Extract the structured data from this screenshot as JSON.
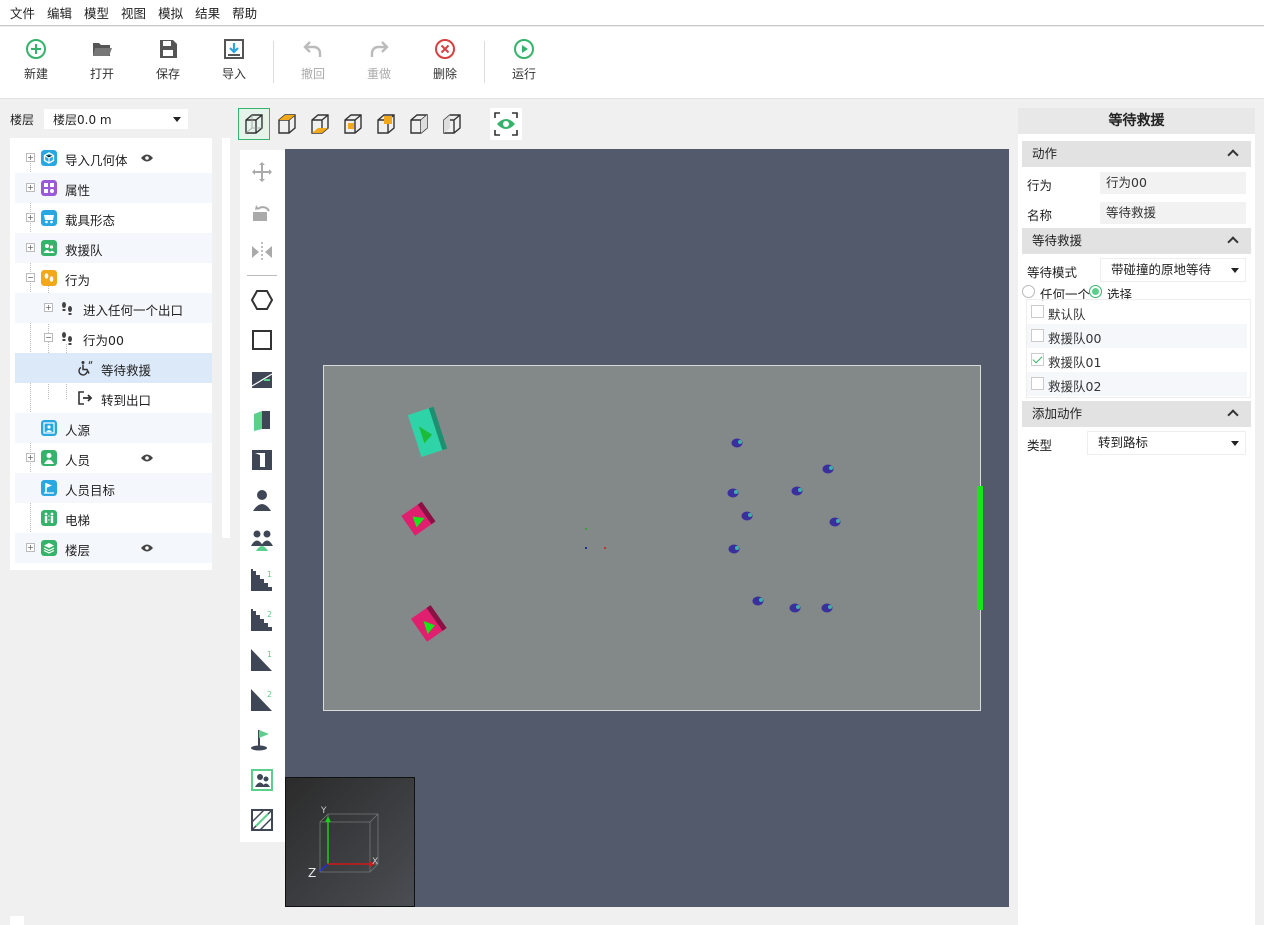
{
  "menu": [
    "文件",
    "编辑",
    "模型",
    "视图",
    "模拟",
    "结果",
    "帮助"
  ],
  "toolbar": {
    "new": "新建",
    "open": "打开",
    "save": "保存",
    "import": "导入",
    "undo": "撤回",
    "redo": "重做",
    "delete": "删除",
    "run": "运行"
  },
  "floor": {
    "label": "楼层",
    "value": "楼层0.0 m"
  },
  "tree": {
    "items": [
      {
        "label": "导入几何体",
        "icon": "geometry-icon",
        "color": "#29a7e0"
      },
      {
        "label": "属性",
        "icon": "property-icon",
        "color": "#9b59d9"
      },
      {
        "label": "载具形态",
        "icon": "vehicle-icon",
        "color": "#29a7e0"
      },
      {
        "label": "救援队",
        "icon": "team-icon",
        "color": "#36b36b"
      },
      {
        "label": "行为",
        "icon": "behavior-icon",
        "color": "#f2a81b"
      },
      {
        "label": "进入任何一个出口",
        "icon": "footsteps-icon"
      },
      {
        "label": "行为00",
        "icon": "footsteps-icon"
      },
      {
        "label": "等待救援",
        "icon": "wheelchair-icon"
      },
      {
        "label": "转到出口",
        "icon": "exit-icon"
      },
      {
        "label": "人源",
        "icon": "source-icon",
        "color": "#29a7e0"
      },
      {
        "label": "人员",
        "icon": "person-icon",
        "color": "#36b36b"
      },
      {
        "label": "人员目标",
        "icon": "target-icon",
        "color": "#29a7e0"
      },
      {
        "label": "电梯",
        "icon": "elevator-icon",
        "color": "#36b36b"
      },
      {
        "label": "楼层",
        "icon": "layers-icon",
        "color": "#36b36b"
      }
    ]
  },
  "panel": {
    "title": "等待救援",
    "action_section": "动作",
    "behavior_label": "行为",
    "behavior_value": "行为00",
    "name_label": "名称",
    "name_value": "等待救援",
    "wait_section": "等待救援",
    "wait_mode_label": "等待模式",
    "wait_mode_value": "带碰撞的原地等待",
    "radio_any": "任何一个",
    "radio_select": "选择",
    "teams": [
      {
        "label": "默认队",
        "checked": false
      },
      {
        "label": "救援队00",
        "checked": false
      },
      {
        "label": "救援队01",
        "checked": true
      },
      {
        "label": "救援队02",
        "checked": false
      }
    ],
    "add_action_section": "添加动作",
    "type_label": "类型",
    "type_value": "转到路标"
  },
  "axes": {
    "y": "Y",
    "x": "X",
    "z": "Z"
  },
  "colors": {
    "accent": "#36b36b",
    "viewport": "#525a6c",
    "floor": "#838989",
    "vehicle_teal": "#2fd3a8",
    "vehicle_pink": "#e0206e",
    "exit_green": "#19e619"
  }
}
